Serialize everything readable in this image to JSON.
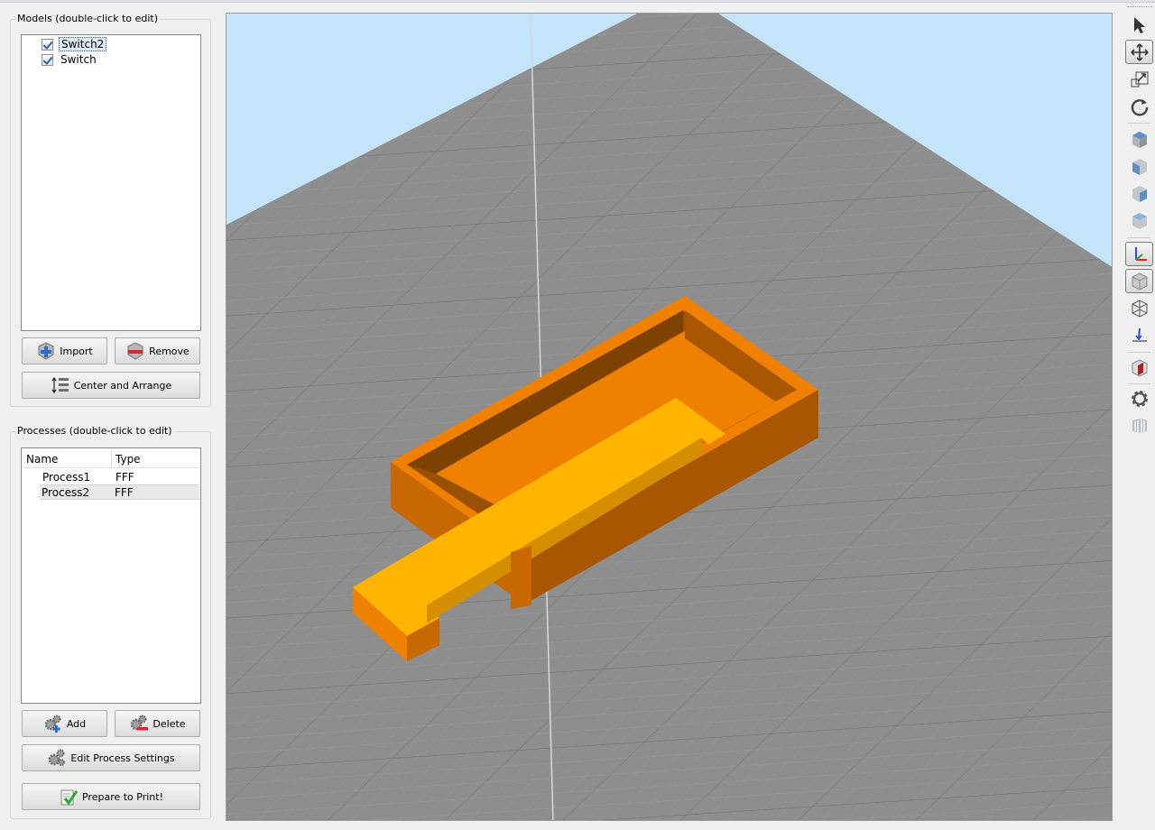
{
  "models_panel": {
    "title": "Models (double-click to edit)",
    "items": [
      {
        "label": "Switch2",
        "checked": true,
        "selected": true
      },
      {
        "label": "Switch",
        "checked": true,
        "selected": false
      }
    ],
    "import_label": "Import",
    "remove_label": "Remove",
    "center_arrange_label": "Center and Arrange"
  },
  "processes_panel": {
    "title": "Processes (double-click to edit)",
    "columns": [
      "Name",
      "Type"
    ],
    "rows": [
      {
        "name": "Process1",
        "type": "FFF"
      },
      {
        "name": "Process2",
        "type": "FFF"
      }
    ],
    "add_label": "Add",
    "delete_label": "Delete",
    "edit_settings_label": "Edit Process Settings",
    "prepare_label": "Prepare to Print!"
  },
  "colors": {
    "sky": "#c4e4f9",
    "bed": "#8e8e8e",
    "model_orange": "#f08000",
    "model_yellow": "#ffb400"
  },
  "toolbar": {
    "icons": [
      "select-arrow-icon",
      "move-icon",
      "scale-icon",
      "rotate-icon",
      "view-cube-icon",
      "view-front-icon",
      "view-side-icon",
      "view-top-icon",
      "axes-icon",
      "solid-view-icon",
      "wireframe-view-icon",
      "place-on-bed-icon",
      "cross-section-icon",
      "settings-gear-icon",
      "bed-icon"
    ]
  }
}
